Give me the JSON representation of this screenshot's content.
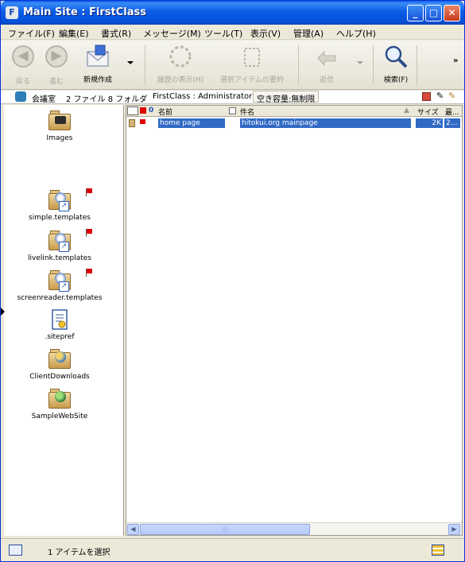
{
  "window": {
    "title": "Main Site : FirstClass"
  },
  "menu": [
    "ファイル(F)",
    "編集(E)",
    "書式(R)",
    "メッセージ(M)",
    "ツール(T)",
    "表示(V)",
    "管理(A)",
    "ヘルプ(H)"
  ],
  "toolbar": {
    "back": "戻る",
    "forward": "進む",
    "new": "新規作成",
    "history": "履歴の表示(H)",
    "summary": "選択アイテムの要約",
    "reply": "返信",
    "search": "検索(F)"
  },
  "info": {
    "location": "会議室",
    "counts": "2 ファイル  8 フォルダ",
    "user": "FirstClass : Administrator",
    "space": "空き容量:無制限"
  },
  "folders": [
    {
      "name": "Images",
      "icon": "camera-folder-icon",
      "flag": false,
      "shortcut": false
    },
    {
      "name": "simple.templates",
      "icon": "template-folder-icon",
      "flag": true,
      "shortcut": true
    },
    {
      "name": "livelink.templates",
      "icon": "template-folder-icon",
      "flag": true,
      "shortcut": true
    },
    {
      "name": "screenreader.templates",
      "icon": "template-folder-icon",
      "flag": true,
      "shortcut": true
    },
    {
      "name": ".sitepref",
      "icon": "document-icon",
      "flag": false,
      "shortcut": false
    },
    {
      "name": "ClientDownloads",
      "icon": "globe-folder-icon",
      "flag": false,
      "shortcut": false
    },
    {
      "name": "SampleWebSite",
      "icon": "globe-folder-icon",
      "flag": false,
      "shortcut": false
    }
  ],
  "table": {
    "headers": {
      "name": "名前",
      "subject": "件名",
      "size": "サイズ",
      "last": "最..."
    },
    "rows": [
      {
        "name": "home page",
        "subject": "hitokui.org mainpage",
        "size": "2K",
        "last": "2..."
      }
    ]
  },
  "scrollbar": {
    "grip": "|||"
  },
  "status": {
    "text": "1 アイテムを選択"
  },
  "colors": {
    "selection": "#316ac5",
    "titlebar": "#0a5fe8",
    "flag": "#e00000"
  }
}
